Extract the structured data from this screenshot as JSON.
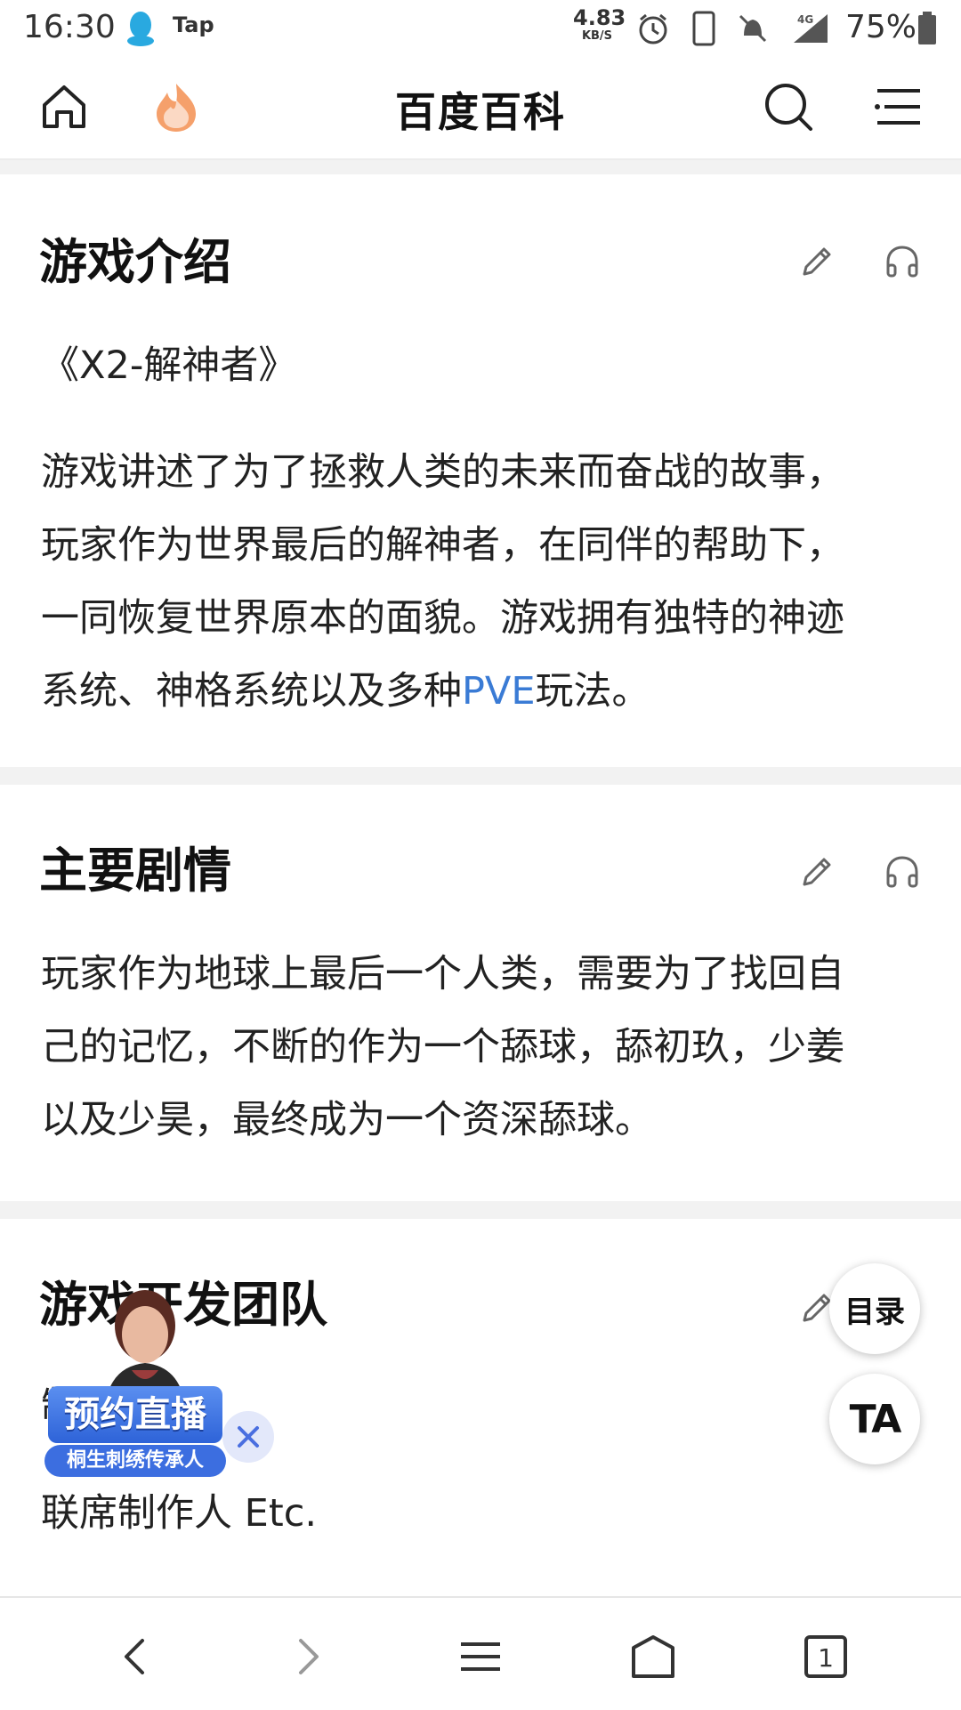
{
  "status_bar": {
    "time": "16:30",
    "tap_label": "Tap",
    "net_speed": "4.83",
    "net_unit": "KB/S",
    "signal_label": "4G",
    "battery": "75%",
    "icons": [
      "qq-icon",
      "alarm-icon",
      "phone-icon",
      "mute-icon",
      "signal-icon",
      "battery-icon"
    ]
  },
  "header": {
    "title": "百度百科",
    "icons": [
      "home-icon",
      "hot-icon",
      "search-icon",
      "menu-icon"
    ],
    "accent_color": "#f08a4b"
  },
  "sections": [
    {
      "title": "游戏介绍",
      "subtitle": "《X2-解神者》",
      "lines": [
        "游戏讲述了为了拯救人类的未来而奋战的故事，",
        "玩家作为世界最后的解神者，在同伴的帮助下，",
        "一同恢复世界原本的面貌。游戏拥有独特的神迹"
      ],
      "last_line_pre": "系统、神格系统以及多种",
      "last_line_link": "PVE",
      "last_line_post": "玩法。"
    },
    {
      "title": "主要剧情",
      "lines": [
        "玩家作为地球上最后一个人类，需要为了找回自",
        "己的记忆，不断的作为一个舔球，舔初玖，少姜",
        "以及少昊，最终成为一个资深舔球。"
      ]
    },
    {
      "title": "游戏开发团队",
      "partial_line": "制        猫溪",
      "line2": "联席制作人 Etc."
    }
  ],
  "floating": {
    "toc_label": "目录",
    "ta_label": "TA"
  },
  "promo": {
    "badge": "预约直播",
    "sub": "桐生刺绣传承人"
  },
  "link_color": "#3a7bd5",
  "bottom_nav": {
    "icons": [
      "back-icon",
      "forward-icon",
      "menu-icon",
      "home-icon",
      "tabs-icon"
    ],
    "tab_count": "1"
  }
}
